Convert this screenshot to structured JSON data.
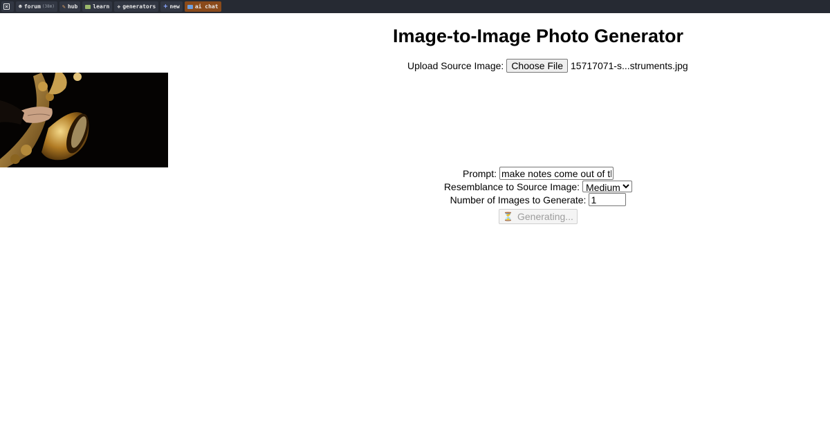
{
  "topbar": {
    "items": [
      {
        "label": "forum",
        "badge": "(38m)",
        "icon": "forum-icon"
      },
      {
        "label": "hub",
        "icon": "hub-icon"
      },
      {
        "label": "learn",
        "icon": "learn-icon"
      },
      {
        "label": "generators",
        "icon": "generators-icon"
      },
      {
        "label": "new",
        "icon": "plus-icon"
      },
      {
        "label": "ai chat",
        "icon": "chat-icon"
      }
    ],
    "close_icon": "close-icon"
  },
  "page": {
    "title": "Image-to-Image Photo Generator"
  },
  "upload": {
    "label": "Upload Source Image:",
    "button_label": "Choose File",
    "file_name": "15717071-s...struments.jpg"
  },
  "form": {
    "prompt_label": "Prompt:",
    "prompt_value": "make notes come out of the",
    "resemblance_label": "Resemblance to Source Image:",
    "resemblance_value": "Medium",
    "count_label": "Number of Images to Generate:",
    "count_value": "1",
    "generate_label": "Generating..."
  },
  "colors": {
    "topbar_bg": "#262a33",
    "chat_accent": "#8a4a1a"
  }
}
